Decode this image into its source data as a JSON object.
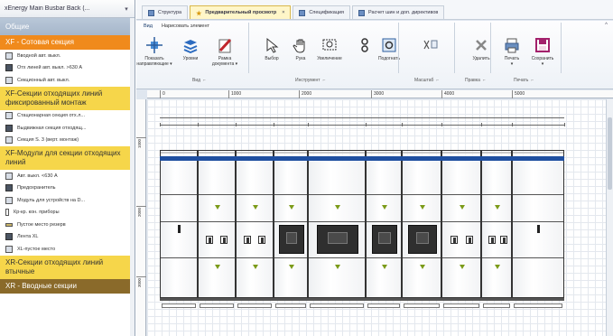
{
  "left_panel": {
    "title": "xEnergy Main Busbar Back (...",
    "pin": "▾",
    "categories": [
      {
        "label": "Общие",
        "style": "general",
        "items": []
      },
      {
        "label": "XF - Сотовая секция",
        "style": "orange",
        "items": [
          "Вводной авт. выкл.",
          "Отх линей авт. выкл. >630 А",
          "Секционный авт. выкл."
        ]
      },
      {
        "label": "XF-Секции отходящих линий фиксированный монтаж",
        "style": "yellow",
        "items": [
          "Стационарная секция отх.л...",
          "Выдвижная секция отходящ...",
          "Секция S. 3 (верт. монтаж)"
        ]
      },
      {
        "label": "XF-Модули для секции отходящих линий",
        "style": "yellow",
        "items": [
          "Авт. выкл. <630 А",
          "Предохранитель",
          "Модуль для устройств на D...",
          "Кр-кр. кон. приборы",
          "Пустое место резерв",
          "Лента XL",
          "XL-пустое место"
        ]
      },
      {
        "label": "XR-Секции отходящих линий втычные",
        "style": "yellow",
        "items": []
      },
      {
        "label": "XR - Вводные секции",
        "style": "dark",
        "items": []
      }
    ]
  },
  "doc_tabs": [
    {
      "label": "Структура",
      "active": false,
      "icon": "structure-icon"
    },
    {
      "label": "Предварительный просмотр",
      "active": true,
      "icon": "star-icon"
    },
    {
      "label": "Спецификация",
      "active": false,
      "icon": "spec-icon"
    },
    {
      "label": "Расчет шин и доп. директивов",
      "active": false,
      "icon": "calc-icon"
    }
  ],
  "ribbon": {
    "tabs": [
      "Вид",
      "Нарисовать элемент"
    ],
    "collapse": "^",
    "buttons": [
      {
        "label": "Показать",
        "sub": "направляющие ▾",
        "icon": "guides-icon"
      },
      {
        "label": "Уровни",
        "sub": "",
        "icon": "layers-icon"
      },
      {
        "label": "Рамка",
        "sub": "документа ▾",
        "icon": "frame-icon"
      },
      {
        "label": "Выбор",
        "sub": "",
        "icon": "select-icon"
      },
      {
        "label": "Рука",
        "sub": "",
        "icon": "hand-icon"
      },
      {
        "label": "Увеличение",
        "sub": "",
        "icon": "zoom-rect-icon"
      },
      {
        "label": "",
        "sub": "",
        "icon": "zoom-icon"
      },
      {
        "label": "Подогнать",
        "sub": "",
        "icon": "fit-icon"
      },
      {
        "label": "",
        "sub": "",
        "icon": "cut-copy-paste-icon"
      },
      {
        "label": "Удалить",
        "sub": "",
        "icon": "delete-icon"
      },
      {
        "label": "Печать",
        "sub": "▾",
        "icon": "print-icon"
      },
      {
        "label": "Сохранить",
        "sub": "▾",
        "icon": "save-icon"
      }
    ],
    "groups": [
      "Вид",
      "Инструмент",
      "Масштаб",
      "Правка",
      "Печать"
    ],
    "expander": "⌐"
  },
  "ruler": {
    "h": [
      "0",
      "1000",
      "2000",
      "3000",
      "4000",
      "5000"
    ],
    "v": [
      "1000",
      "2000",
      "3000"
    ]
  },
  "colors": {
    "busbar": "#1f4fa0",
    "orange": "#f08a1c",
    "yellow": "#f6d64a",
    "active_tab": "#fff6c8",
    "marker": "#7c9b1a"
  }
}
